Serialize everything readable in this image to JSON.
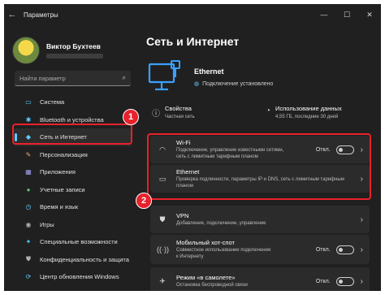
{
  "window": {
    "title": "Параметры",
    "controls": [
      "—",
      "☐",
      "✕"
    ]
  },
  "profile": {
    "name": "Виктор Бухтеев"
  },
  "search": {
    "placeholder": "Найти параметр"
  },
  "sidebar": {
    "items": [
      {
        "label": "Система",
        "icon": "monitor-icon",
        "glyph": "▭",
        "color": "#60cdff"
      },
      {
        "label": "Bluetooth и устройства",
        "icon": "bluetooth-icon",
        "glyph": "✱",
        "color": "#60cdff"
      },
      {
        "label": "Сеть и Интернет",
        "icon": "network-icon",
        "glyph": "◆",
        "color": "#60cdff",
        "active": true
      },
      {
        "label": "Персонализация",
        "icon": "brush-icon",
        "glyph": "✎",
        "color": "#f0a868"
      },
      {
        "label": "Приложения",
        "icon": "apps-icon",
        "glyph": "▦",
        "color": "#a0a0e8"
      },
      {
        "label": "Учетные записи",
        "icon": "person-icon",
        "glyph": "●",
        "color": "#5fc46a"
      },
      {
        "label": "Время и язык",
        "icon": "globe-clock-icon",
        "glyph": "◷",
        "color": "#60cdff"
      },
      {
        "label": "Игры",
        "icon": "gamepad-icon",
        "glyph": "◉",
        "color": "#b0b0b0"
      },
      {
        "label": "Специальные возможности",
        "icon": "accessibility-icon",
        "glyph": "✦",
        "color": "#60cdff"
      },
      {
        "label": "Конфиденциальность и защита",
        "icon": "shield-icon",
        "glyph": "⛊",
        "color": "#b0b0b0"
      },
      {
        "label": "Центр обновления Windows",
        "icon": "update-icon",
        "glyph": "⟳",
        "color": "#60cdff"
      }
    ]
  },
  "main": {
    "title": "Сеть и Интернет",
    "connection": {
      "name": "Ethernet",
      "status": "Подключение установлено"
    },
    "quick": [
      {
        "title": "Свойства",
        "subtitle": "Частная сеть",
        "icon": "info-icon"
      },
      {
        "title": "Использование данных",
        "subtitle": "4,55 ГБ, последние 30 дней",
        "icon": "data-usage-icon"
      }
    ],
    "cards": [
      {
        "title": "Wi-Fi",
        "subtitle": "Подключение, управление известными сетями, сеть с лимитным тарифным планом",
        "toggle_label": "Откл.",
        "icon": "wifi-icon"
      },
      {
        "title": "Ethernet",
        "subtitle": "Проверка подлинности, параметры IP и DNS, сеть с лимитным тарифным планом",
        "icon": "ethernet-icon"
      },
      {
        "title": "VPN",
        "subtitle": "Добавление, подключение, управление",
        "icon": "vpn-shield-icon"
      },
      {
        "title": "Мобильный хот-спот",
        "subtitle": "Совместное использование подключения к Интернету",
        "toggle_label": "Откл.",
        "icon": "hotspot-icon"
      },
      {
        "title": "Режим «в самолете»",
        "subtitle": "Остановка беспроводной связи",
        "toggle_label": "Откл.",
        "icon": "airplane-icon"
      }
    ]
  },
  "annotations": {
    "badge1": "1",
    "badge2": "2",
    "color": "#e8212b"
  }
}
